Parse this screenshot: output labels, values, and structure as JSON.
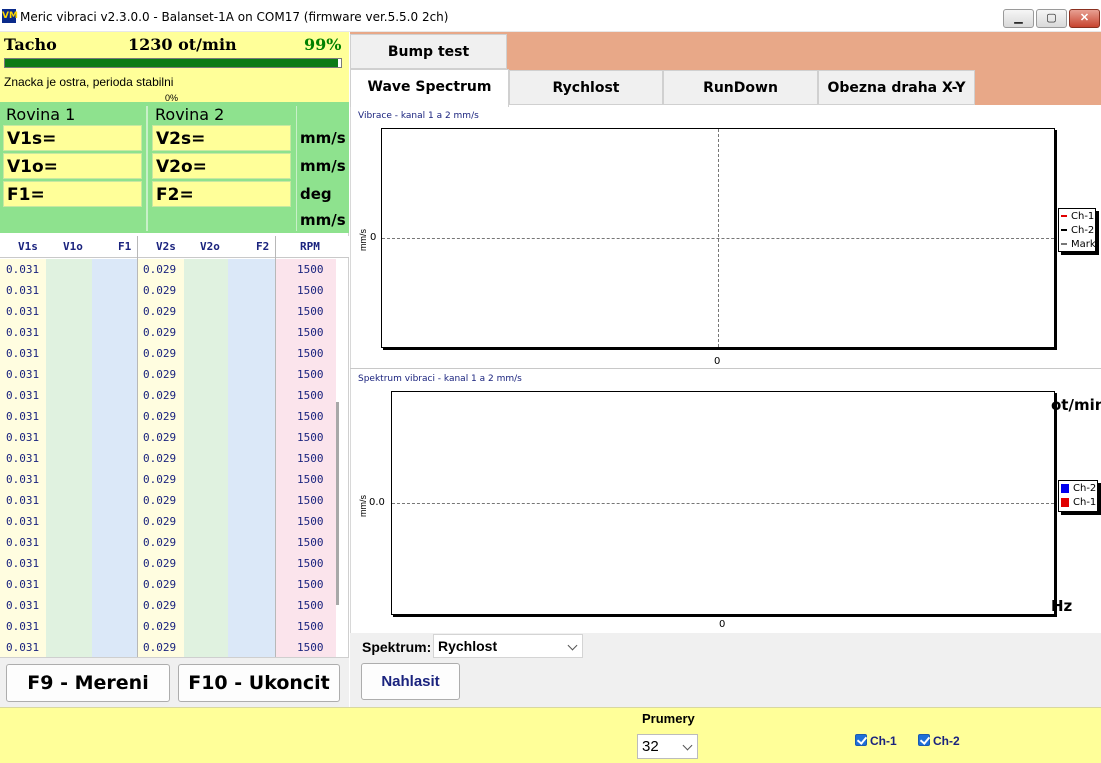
{
  "window": {
    "logo_text": "VM",
    "title": "Meric vibraci v2.3.0.0 - Balanset-1A on COM17 (firmware ver.5.5.0 2ch)",
    "min_glyph": "▁",
    "max_glyph": "▢",
    "close_glyph": "✕"
  },
  "tacho": {
    "label": "Tacho",
    "rpm": "1230 ot/min",
    "percent": "99%",
    "bar_fraction": 0.99,
    "status": "Znacka je ostra, perioda stabilni",
    "progress": "0%"
  },
  "planes": {
    "plane1": "Rovina 1",
    "plane2": "Rovina 2",
    "v1s": "V1s=",
    "v1o": "V1o=",
    "f1": "F1=",
    "v2s": "V2s=",
    "v2o": "V2o=",
    "f2": "F2=",
    "units": [
      "mm/s",
      "mm/s",
      "deg",
      "mm/s"
    ]
  },
  "table": {
    "headers": [
      "V1s",
      "V1o",
      "F1",
      "V2s",
      "V2o",
      "F2",
      "RPM"
    ],
    "rows": [
      [
        "0.031",
        "0.029",
        "1500"
      ],
      [
        "0.031",
        "0.029",
        "1500"
      ],
      [
        "0.031",
        "0.029",
        "1500"
      ],
      [
        "0.031",
        "0.029",
        "1500"
      ],
      [
        "0.031",
        "0.029",
        "1500"
      ],
      [
        "0.031",
        "0.029",
        "1500"
      ],
      [
        "0.031",
        "0.029",
        "1500"
      ],
      [
        "0.031",
        "0.029",
        "1500"
      ],
      [
        "0.031",
        "0.029",
        "1500"
      ],
      [
        "0.031",
        "0.029",
        "1500"
      ],
      [
        "0.031",
        "0.029",
        "1500"
      ],
      [
        "0.031",
        "0.029",
        "1500"
      ],
      [
        "0.031",
        "0.029",
        "1500"
      ],
      [
        "0.031",
        "0.029",
        "1500"
      ],
      [
        "0.031",
        "0.029",
        "1500"
      ],
      [
        "0.031",
        "0.029",
        "1500"
      ],
      [
        "0.031",
        "0.029",
        "1500"
      ],
      [
        "0.031",
        "0.029",
        "1500"
      ],
      [
        "0.031",
        "0.029",
        "1500"
      ]
    ]
  },
  "buttons": {
    "f9": "F9 - Mereni",
    "f10": "F10 - Ukoncit",
    "nahlasit": "Nahlasit"
  },
  "tabs": {
    "bump": "Bump test",
    "wave": "Wave Spectrum",
    "rychlost": "Rychlost",
    "rundown": "RunDown",
    "obezna": "Obezna draha X-Y"
  },
  "chart1": {
    "title": "Vibrace  - kanal 1 a 2 mm/s",
    "ylabel": "mm/s",
    "ytick": "0",
    "xtick": "0",
    "legend": [
      "Ch-1",
      "Ch-2",
      "Mark"
    ],
    "legend_colors": [
      "#e00000",
      "#000000",
      "#777777"
    ]
  },
  "chart2": {
    "title": "Spektrum vibraci  - kanal 1 a 2 mm/s",
    "ylabel": "mm/s",
    "ytick": "0.0",
    "xtick": "0",
    "unit_top": "ot/min",
    "unit_bottom": "Hz",
    "legend": [
      "Ch-2",
      "Ch-1"
    ],
    "legend_colors": [
      "#0000ee",
      "#e00000"
    ]
  },
  "spektrum": {
    "label": "Spektrum:",
    "value": "Rychlost"
  },
  "bottom": {
    "prumery_label": "Prumery",
    "prumery_value": "32",
    "ch1": "Ch-1",
    "ch2": "Ch-2"
  }
}
